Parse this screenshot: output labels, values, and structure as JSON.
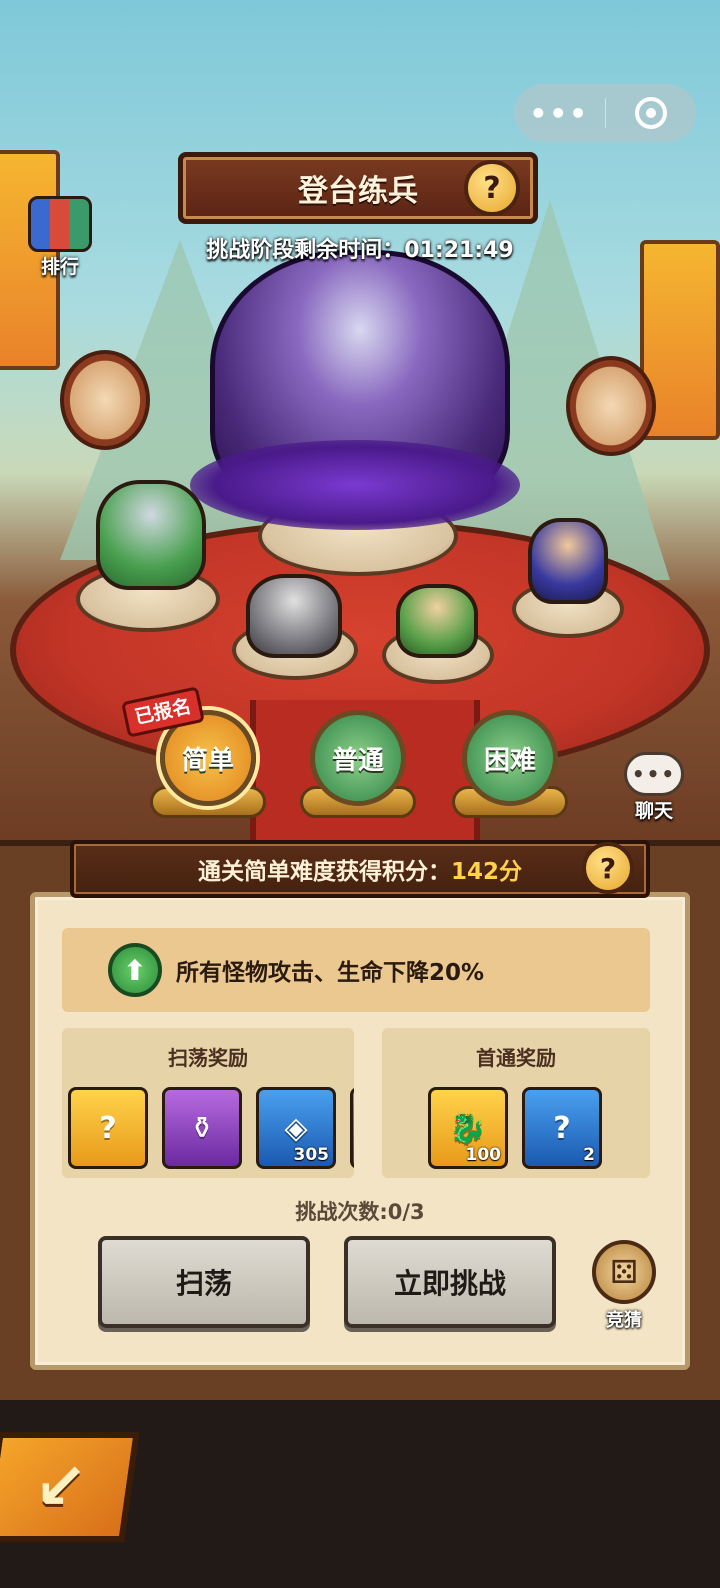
{
  "mini_program_bar": {
    "more_icon": "more-dots-icon",
    "close_icon": "target-circle-icon"
  },
  "header": {
    "title": "登台练兵",
    "timer_label": "挑战阶段剩余时间：",
    "timer_value": "01:21:49"
  },
  "sidebar": {
    "rank_label": "排行",
    "chat_label": "聊天"
  },
  "difficulty": {
    "registered_tag": "已报名",
    "options": [
      {
        "label": "简单",
        "selected": true
      },
      {
        "label": "普通",
        "selected": false
      },
      {
        "label": "困难",
        "selected": false
      }
    ]
  },
  "score_bar": {
    "label": "通关简单难度获得积分：",
    "value": "142分"
  },
  "buff": {
    "icon": "up-arrow-icon",
    "text": "所有怪物攻击、生命下降20%"
  },
  "sweep_rewards": {
    "title": "扫荡奖励",
    "items": [
      {
        "icon": "mystery-chest-icon",
        "rarity": "gold",
        "count": ""
      },
      {
        "icon": "wine-jar-icon",
        "rarity": "purple",
        "count": ""
      },
      {
        "icon": "copper-coin-icon",
        "rarity": "blue",
        "count": "305"
      }
    ]
  },
  "first_clear_rewards": {
    "title": "首通奖励",
    "items": [
      {
        "icon": "dragon-token-icon",
        "rarity": "gold",
        "count": "100"
      },
      {
        "icon": "mystery-chest-icon",
        "rarity": "blue",
        "count": "2"
      }
    ]
  },
  "attempts": "挑战次数:0/3",
  "buttons": {
    "sweep": "扫荡",
    "challenge": "立即挑战",
    "guess": "竞猜"
  },
  "colors": {
    "accent_gold": "#ffd24a",
    "tag_red": "#d8302a",
    "panel_brown": "#6a4024",
    "parchment": "#f2e4c4"
  }
}
